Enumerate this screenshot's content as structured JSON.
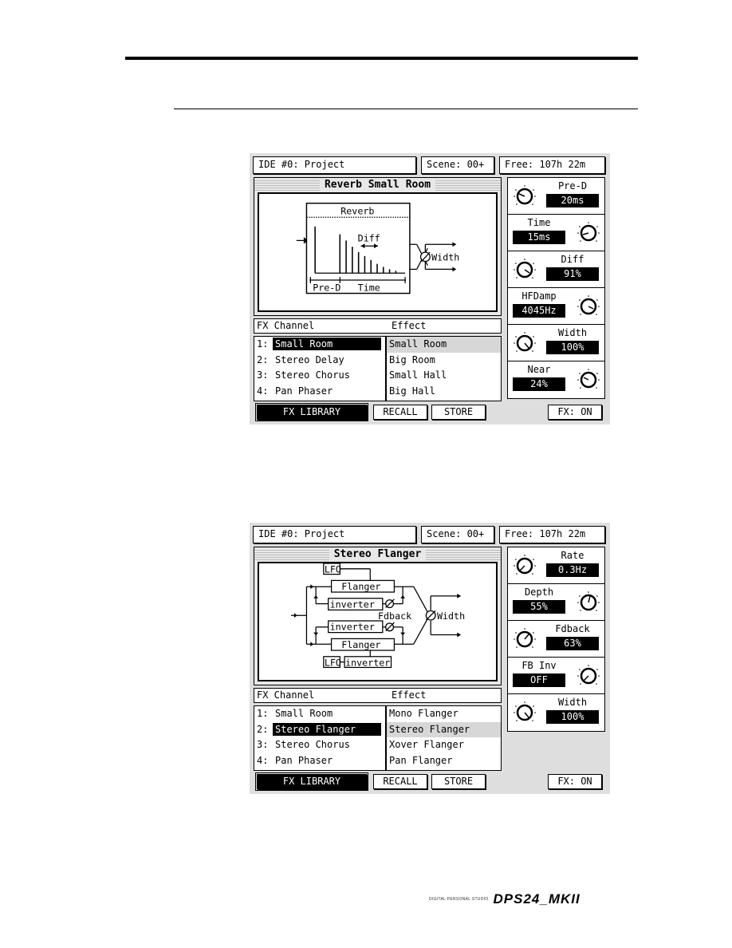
{
  "page": {
    "footer": {
      "brand_small": "DIGITAL PERSONAL STUDIO",
      "brand_large": "DPS24_MKII"
    }
  },
  "screens": [
    {
      "header": {
        "project": "IDE #0: Project",
        "scene": "Scene: 00+",
        "free": "Free: 107h 22m"
      },
      "title": "Reverb Small Room",
      "diagram": {
        "labels": {
          "block": "Reverb",
          "diff": "Diff",
          "pred": "Pre-D",
          "time": "Time",
          "width": "Width"
        }
      },
      "fx_header": {
        "channel": "FX Channel",
        "effect": "Effect"
      },
      "channels": [
        {
          "num": "1:",
          "label": "Small Room",
          "selected": true
        },
        {
          "num": "2:",
          "label": "Stereo Delay",
          "selected": false
        },
        {
          "num": "3:",
          "label": "Stereo Chorus",
          "selected": false
        },
        {
          "num": "4:",
          "label": "Pan Phaser",
          "selected": false
        }
      ],
      "effects": [
        {
          "label": "Small Room",
          "selected": true
        },
        {
          "label": "Big Room",
          "selected": false
        },
        {
          "label": "Small Hall",
          "selected": false
        },
        {
          "label": "Big Hall",
          "selected": false
        }
      ],
      "params": [
        {
          "label": "Pre-D",
          "value": "20ms",
          "knob": "left"
        },
        {
          "label": "Time",
          "value": "15ms",
          "knob": "right"
        },
        {
          "label": "Diff",
          "value": "91%",
          "knob": "left"
        },
        {
          "label": "HFDamp",
          "value": "4045Hz",
          "knob": "right"
        },
        {
          "label": "Width",
          "value": "100%",
          "knob": "left"
        },
        {
          "label": "Near",
          "value": "24%",
          "knob": "right"
        }
      ],
      "buttons": {
        "library": "FX LIBRARY",
        "recall": "RECALL",
        "store": "STORE",
        "fx": "FX: ON"
      }
    },
    {
      "header": {
        "project": "IDE #0: Project",
        "scene": "Scene: 00+",
        "free": "Free: 107h 22m"
      },
      "title": "Stereo Flanger",
      "diagram": {
        "labels": {
          "lfo": "LFO",
          "flanger": "Flanger",
          "inverter": "inverter",
          "fdback": "Fdback",
          "width": "Width"
        }
      },
      "fx_header": {
        "channel": "FX Channel",
        "effect": "Effect"
      },
      "channels": [
        {
          "num": "1:",
          "label": "Small Room",
          "selected": false
        },
        {
          "num": "2:",
          "label": "Stereo Flanger",
          "selected": true
        },
        {
          "num": "3:",
          "label": "Stereo Chorus",
          "selected": false
        },
        {
          "num": "4:",
          "label": "Pan Phaser",
          "selected": false
        }
      ],
      "effects": [
        {
          "label": "Mono Flanger",
          "selected": false
        },
        {
          "label": "Stereo Flanger",
          "selected": true
        },
        {
          "label": "Xover Flanger",
          "selected": false
        },
        {
          "label": "Pan Flanger",
          "selected": false
        }
      ],
      "params": [
        {
          "label": "Rate",
          "value": "0.3Hz",
          "knob": "left"
        },
        {
          "label": "Depth",
          "value": "55%",
          "knob": "right"
        },
        {
          "label": "Fdback",
          "value": "63%",
          "knob": "left"
        },
        {
          "label": "FB Inv",
          "value": "OFF",
          "knob": "right"
        },
        {
          "label": "Width",
          "value": "100%",
          "knob": "left"
        }
      ],
      "buttons": {
        "library": "FX LIBRARY",
        "recall": "RECALL",
        "store": "STORE",
        "fx": "FX: ON"
      }
    }
  ]
}
